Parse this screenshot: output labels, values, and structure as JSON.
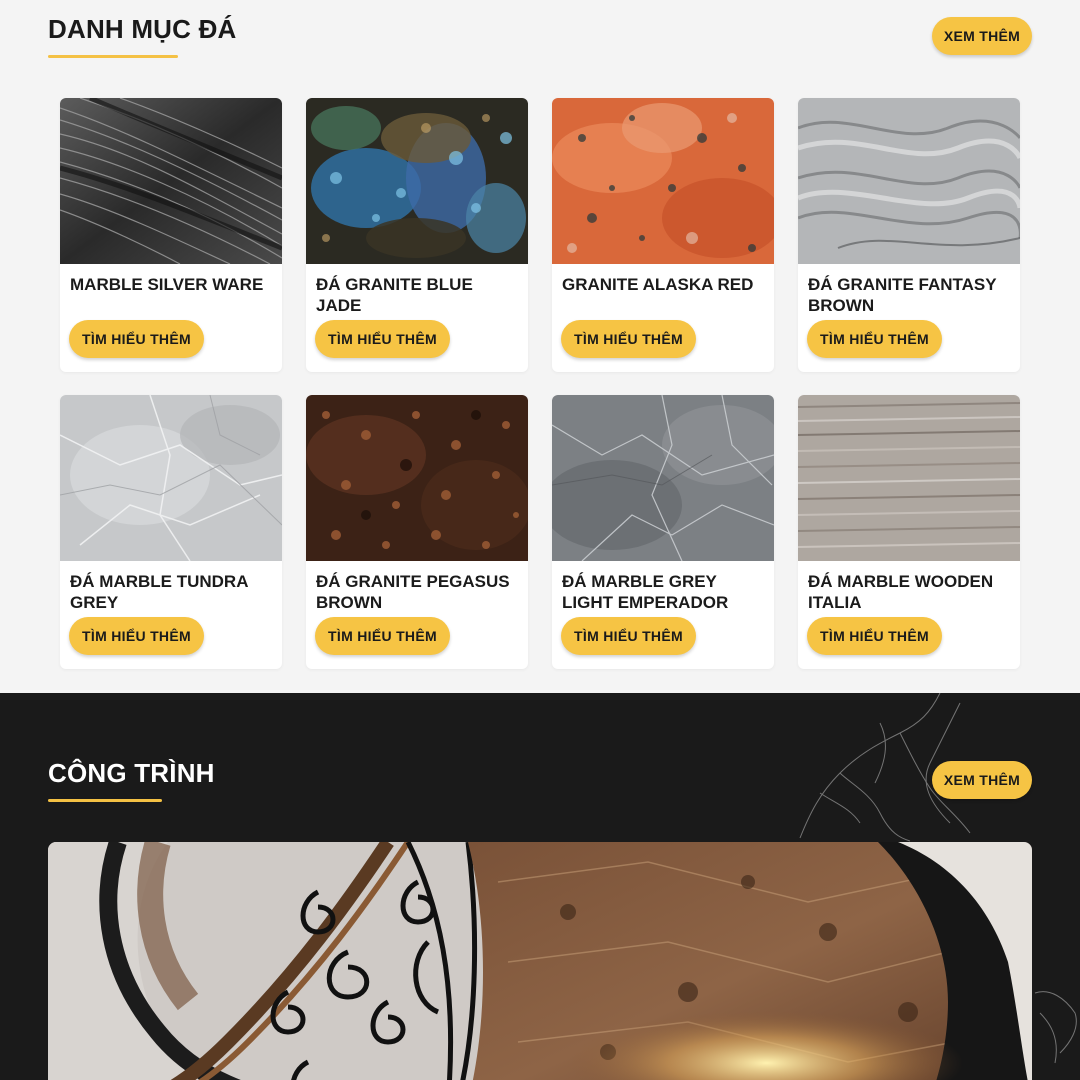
{
  "categories": {
    "title": "DANH MỤC ĐÁ",
    "more_label": "XEM THÊM",
    "accent_color": "#f6c444",
    "items": [
      {
        "name": "MARBLE SILVER WARE",
        "button": "TÌM HIỂU THÊM",
        "image": "black-silver-veined-marble"
      },
      {
        "name": "ĐÁ GRANITE BLUE JADE",
        "button": "TÌM HIỂU THÊM",
        "image": "blue-labradorite-granite"
      },
      {
        "name": "GRANITE ALASKA RED",
        "button": "TÌM HIỂU THÊM",
        "image": "red-orange-granite"
      },
      {
        "name": "ĐÁ GRANITE FANTASY BROWN",
        "button": "TÌM HIỂU THÊM",
        "image": "grey-wavy-granite"
      },
      {
        "name": "ĐÁ MARBLE TUNDRA GREY",
        "button": "TÌM HIỂU THÊM",
        "image": "light-grey-veined-marble"
      },
      {
        "name": "ĐÁ GRANITE PEGASUS BROWN",
        "button": "TÌM HIỂU THÊM",
        "image": "brown-speckled-granite"
      },
      {
        "name": "ĐÁ MARBLE GREY LIGHT EMPERADOR",
        "button": "TÌM HIỂU THÊM",
        "image": "grey-emperador-marble"
      },
      {
        "name": "ĐÁ MARBLE WOODEN ITALIA",
        "button": "TÌM HIỂU THÊM",
        "image": "wood-grain-marble"
      }
    ]
  },
  "projects": {
    "title": "CÔNG TRÌNH",
    "more_label": "XEM THÊM",
    "image": "spiral-marble-staircase"
  }
}
